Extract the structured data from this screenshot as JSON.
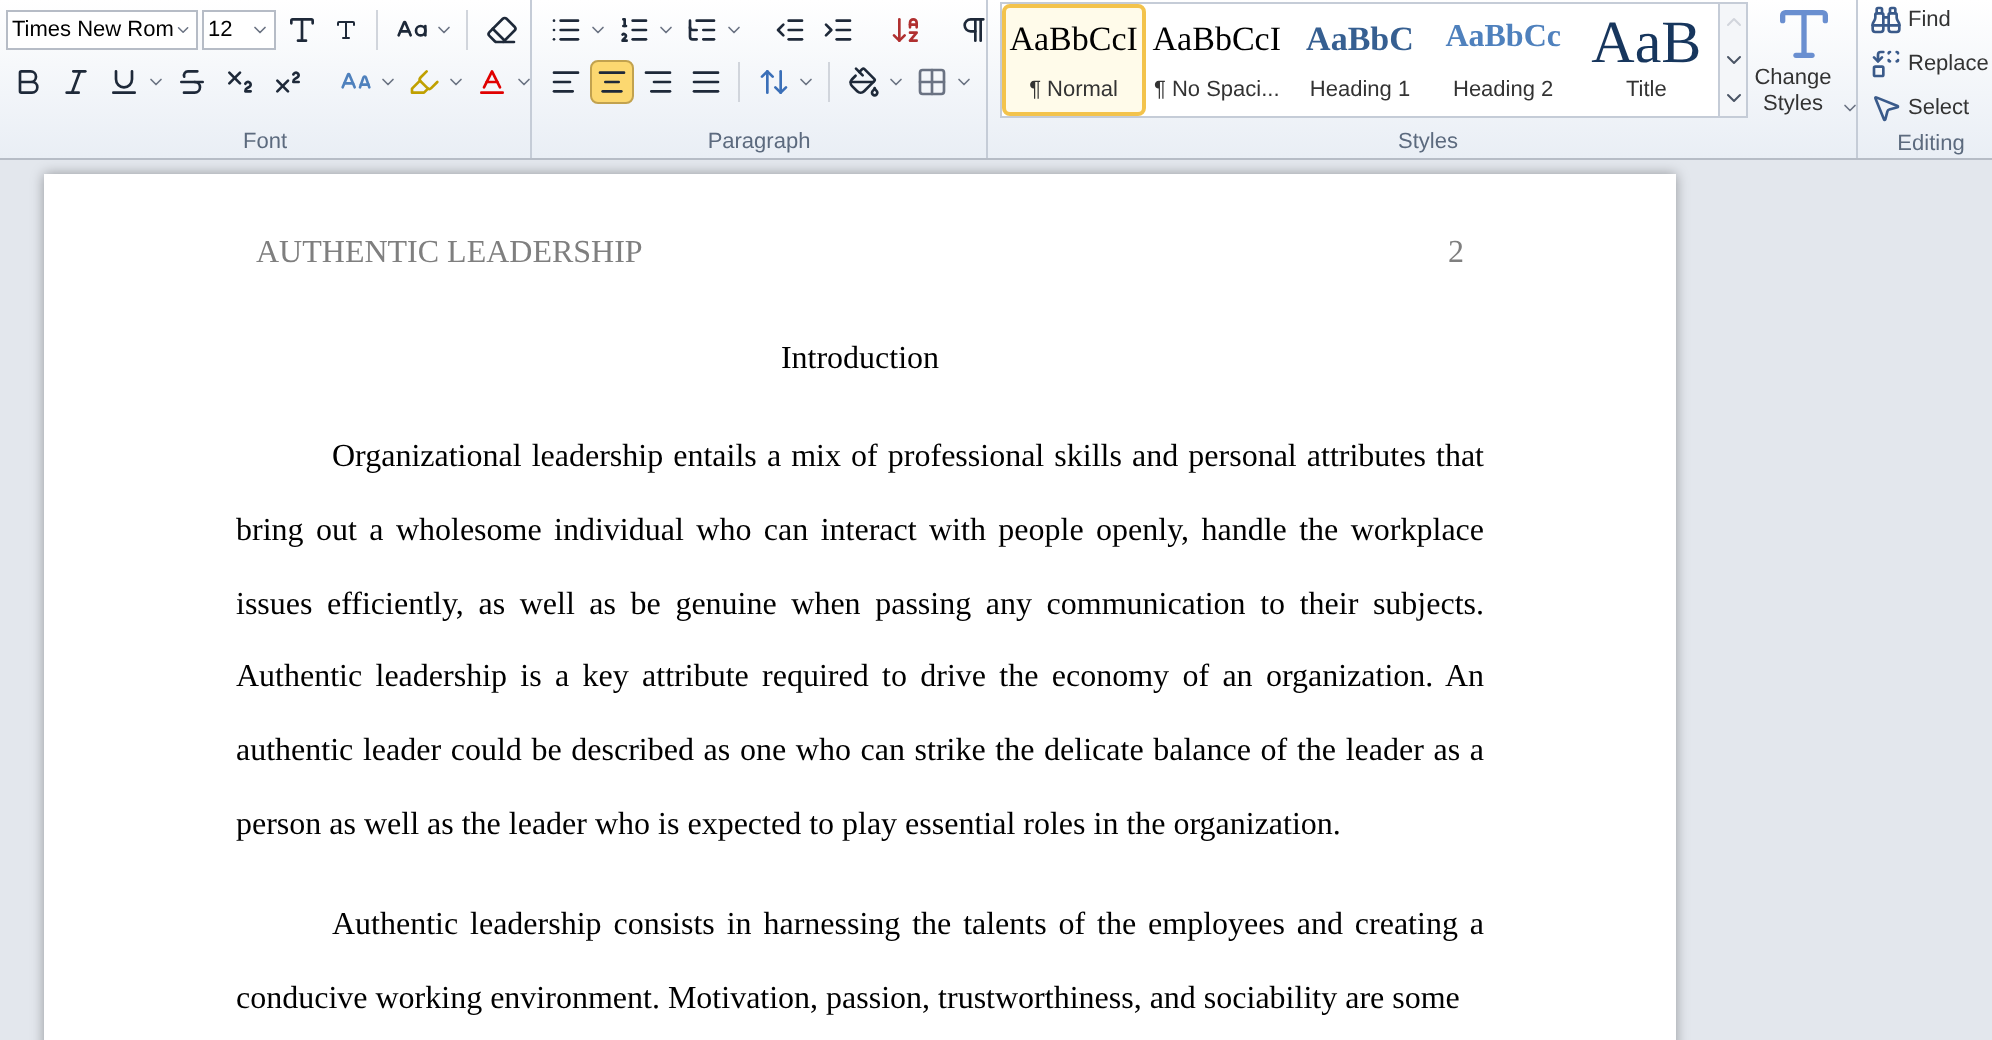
{
  "ribbon": {
    "font": {
      "name": "Times New Rom",
      "size": "12",
      "label": "Font"
    },
    "paragraph": {
      "label": "Paragraph",
      "alignment": [
        {
          "kind": "left",
          "selected": false
        },
        {
          "kind": "center",
          "selected": true
        },
        {
          "kind": "right",
          "selected": false
        },
        {
          "kind": "justify",
          "selected": false
        }
      ]
    },
    "styles": {
      "label": "Styles",
      "items": [
        {
          "kind": "normal",
          "sample": "AaBbCcI",
          "label": "¶ Normal",
          "selected": true
        },
        {
          "kind": "nospacing",
          "sample": "AaBbCcI",
          "label": "¶ No Spaci...",
          "selected": false
        },
        {
          "kind": "heading1",
          "sample": "AaBbC",
          "label": "Heading 1",
          "selected": false
        },
        {
          "kind": "heading2",
          "sample": "AaBbCc",
          "label": "Heading 2",
          "selected": false
        },
        {
          "kind": "title",
          "sample": "AaB",
          "label": "Title",
          "selected": false
        }
      ],
      "change_styles": "Change Styles"
    },
    "editing": {
      "label": "Editing",
      "items": [
        {
          "kind": "find",
          "label": "Find"
        },
        {
          "kind": "replace",
          "label": "Replace"
        },
        {
          "kind": "select",
          "label": "Select"
        }
      ]
    }
  },
  "document": {
    "header": {
      "title": "AUTHENTIC LEADERSHIP",
      "page": "2"
    },
    "heading": "Introduction",
    "paragraphs": [
      "Organizational leadership entails a mix of professional skills and personal attributes that bring out a wholesome individual who can interact with people openly, handle the workplace issues efficiently, as well as be genuine when passing any communication to their subjects. Authentic leadership is a key attribute required to drive the economy of an organization. An authentic leader could be described as one who can strike the delicate balance of the leader as a person as well as the leader who is expected to play essential roles in the organization.",
      "Authentic leadership consists in harnessing the talents of the employees and creating a conducive working environment. Motivation, passion, trustworthiness, and sociability are some"
    ]
  }
}
